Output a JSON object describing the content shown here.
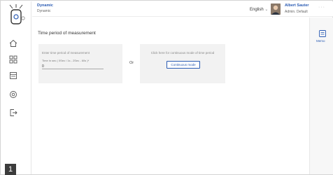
{
  "header": {
    "app_title": "Dynamic",
    "app_subtitle": "Dynamic",
    "language": "English",
    "language_chevron": "⌄",
    "user_name": "Albert Sauter",
    "user_role": "Admin. Default",
    "more": "···"
  },
  "sidebar": {
    "items": [
      {
        "icon": "home-icon"
      },
      {
        "icon": "dashboard-icon"
      },
      {
        "icon": "list-icon"
      },
      {
        "icon": "settings-icon"
      },
      {
        "icon": "logout-icon"
      }
    ],
    "badge": "1"
  },
  "main": {
    "title": "Time period of measurement",
    "manual": {
      "hint": "Enter time period of measurement",
      "format": "Time in sec ( 0Sec / 1s - 2Sec - 60s )*",
      "value": "0"
    },
    "or_label": "Or",
    "continuous": {
      "hint": "Click here for continuous mode of time period",
      "button_label": "Continuous mode"
    }
  },
  "right_panel": {
    "memo_label": "Memo"
  },
  "colors": {
    "accent": "#2a5bb3",
    "card_bg": "#f2f2f2"
  }
}
